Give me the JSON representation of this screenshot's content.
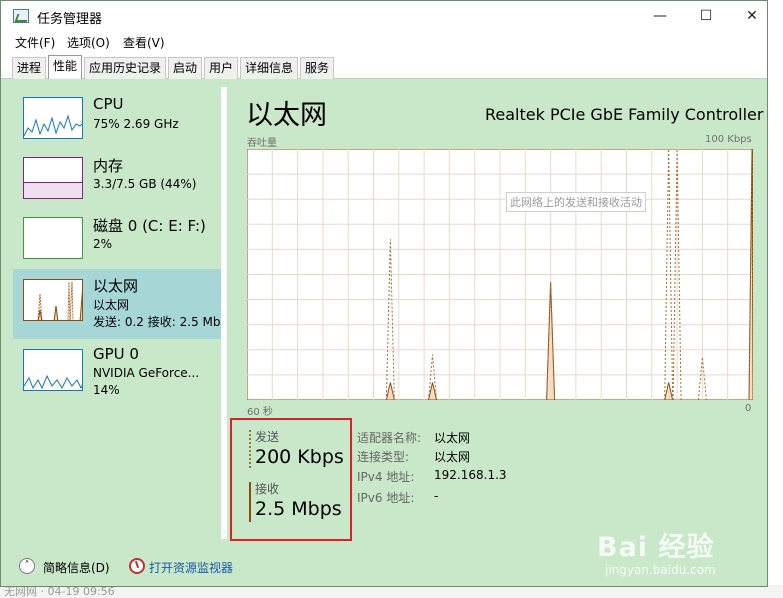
{
  "window": {
    "title": "任务管理器",
    "min_symbol": "—",
    "max_symbol": "☐",
    "close_symbol": "✕"
  },
  "menu": [
    "文件(F)",
    "选项(O)",
    "查看(V)"
  ],
  "tabs": [
    "进程",
    "性能",
    "应用历史记录",
    "启动",
    "用户",
    "详细信息",
    "服务"
  ],
  "active_tab": "性能",
  "sidebar": {
    "items": [
      {
        "title": "CPU",
        "line1": "75% 2.69 GHz",
        "line2": ""
      },
      {
        "title": "内存",
        "line1": "3.3/7.5 GB (44%)",
        "line2": ""
      },
      {
        "title": "磁盘 0 (C: E: F:)",
        "line1": "2%",
        "line2": ""
      },
      {
        "title": "以太网",
        "line1": "以太网",
        "line2": "发送: 0.2 接收: 2.5 Mb"
      },
      {
        "title": "GPU 0",
        "line1": "NVIDIA GeForce...",
        "line2": "14%"
      }
    ],
    "selected": "以太网"
  },
  "main": {
    "title": "以太网",
    "device_name": "Realtek PCIe GbE Family Controller",
    "graph_left_label": "吞吐量",
    "graph_right_label": "100 Kbps",
    "axis_left": "60 秒",
    "axis_right": "0",
    "tooltip": "此网络上的发送和接收活动"
  },
  "stats": {
    "send_label": "发送",
    "send_value": "200 Kbps",
    "recv_label": "接收",
    "recv_value": "2.5 Mbps"
  },
  "info": [
    {
      "key": "适配器名称:",
      "value": "以太网"
    },
    {
      "key": "连接类型:",
      "value": "以太网"
    },
    {
      "key": "IPv4 地址:",
      "value": "192.168.1.3"
    },
    {
      "key": "IPv6 地址:",
      "value": "-"
    }
  ],
  "footer": {
    "brief": "简略信息(D)",
    "monitor": "打开资源监视器"
  },
  "watermark": {
    "logo": "Bai 经验",
    "url": "jingyan.baidu.com"
  },
  "background_text": "无网网 · 04-19 09:56",
  "colors": {
    "window_bg": "#c9e7c9",
    "selected_item": "#a7d6d6",
    "graph_line": "#8b4d10",
    "graph_send_dotted": "#b06a2a",
    "graph_grid": "#ecd8c8",
    "highlight_box": "#e02020",
    "link": "#1a5aa8"
  },
  "chart_data": {
    "type": "area",
    "x_range": [
      60,
      0
    ],
    "receive_peaks": [
      {
        "x_seconds_ago": 43,
        "value": 0.07
      },
      {
        "x_seconds_ago": 38,
        "value": 0.07
      },
      {
        "x_seconds_ago": 24,
        "value": 0.47
      },
      {
        "x_seconds_ago": 10,
        "value": 0.07
      },
      {
        "x_seconds_ago": 0,
        "value": 1.0
      }
    ],
    "send_peaks": [
      {
        "x_seconds_ago": 43,
        "value": 0.64
      },
      {
        "x_seconds_ago": 38,
        "value": 0.18
      },
      {
        "x_seconds_ago": 24,
        "value": 0.47
      },
      {
        "x_seconds_ago": 10,
        "value": 1.0
      },
      {
        "x_seconds_ago": 9,
        "value": 1.0
      },
      {
        "x_seconds_ago": 6,
        "value": 0.17
      },
      {
        "x_seconds_ago": 0,
        "value": 1.0
      }
    ],
    "grid": true
  }
}
